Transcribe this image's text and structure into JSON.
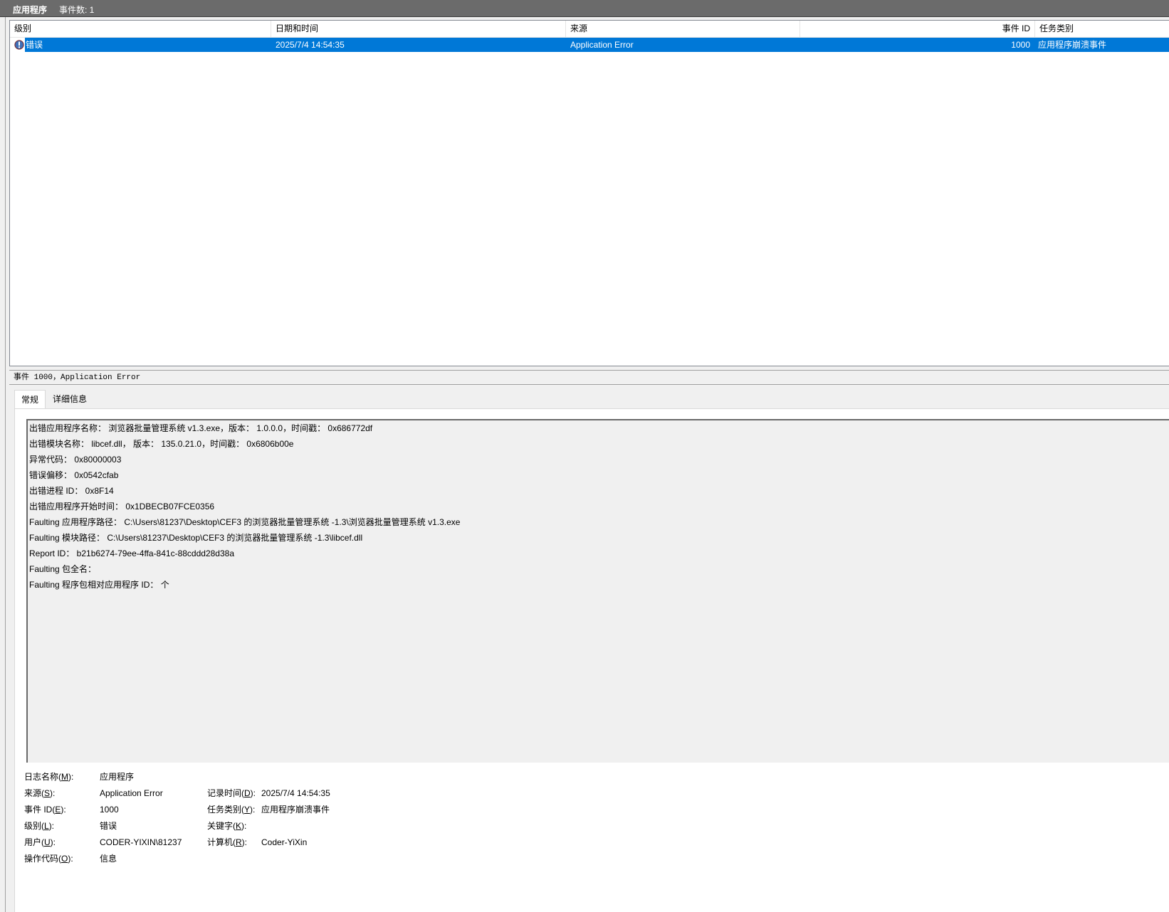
{
  "titlebar": {
    "log_name": "应用程序",
    "event_count": "事件数: 1"
  },
  "columns": [
    "级别",
    "日期和时间",
    "来源",
    "事件 ID",
    "任务类别"
  ],
  "events": [
    {
      "level": "错误",
      "datetime": "2025/7/4 14:54:35",
      "source": "Application Error",
      "event_id": "1000",
      "task": "应用程序崩溃事件",
      "icon": "error-icon",
      "selected": true
    }
  ],
  "detail": {
    "title": "事件 1000，Application Error",
    "tabs": [
      "常规",
      "详细信息"
    ],
    "description": [
      "出错应用程序名称： 浏览器批量管理系统 v1.3.exe，版本： 1.0.0.0，时间戳： 0x686772df",
      "出错模块名称： libcef.dll， 版本： 135.0.21.0，时间戳： 0x6806b00e",
      "异常代码： 0x80000003",
      "错误偏移： 0x0542cfab",
      "出错进程 ID： 0x8F14",
      "出错应用程序开始时间： 0x1DBECB07FCE0356",
      "Faulting 应用程序路径： C:\\Users\\81237\\Desktop\\CEF3 的浏览器批量管理系统 -1.3\\浏览器批量管理系统 v1.3.exe",
      "Faulting 模块路径： C:\\Users\\81237\\Desktop\\CEF3 的浏览器批量管理系统 -1.3\\libcef.dll",
      "Report ID： b21b6274-79ee-4ffa-841c-88cddd28d38a",
      "Faulting 包全名：",
      "Faulting 程序包相对应用程序 ID： 个"
    ],
    "properties": {
      "log_name_label": [
        "日志名称(",
        "M",
        "):"
      ],
      "log_name_value": "应用程序",
      "source_label": [
        "来源(",
        "S",
        "):"
      ],
      "source_value": "Application Error",
      "logged_label": [
        "记录时间(",
        "D",
        "):"
      ],
      "logged_value": "2025/7/4 14:54:35",
      "event_id_label": [
        "事件 ID(",
        "E",
        "):"
      ],
      "event_id_value": "1000",
      "task_label": [
        "任务类别(",
        "Y",
        "):"
      ],
      "task_value": "应用程序崩溃事件",
      "level_label": [
        "级别(",
        "L",
        "):"
      ],
      "level_value": "错误",
      "keywords_label": [
        "关键字(",
        "K",
        "):"
      ],
      "keywords_value": "",
      "user_label": [
        "用户(",
        "U",
        "):"
      ],
      "user_value": "CODER-YIXIN\\81237",
      "computer_label": [
        "计算机(",
        "R",
        "):"
      ],
      "computer_value": "Coder-YiXin",
      "opcode_label": [
        "操作代码(",
        "O",
        "):"
      ],
      "opcode_value": "信息"
    }
  },
  "colors": {
    "selection": "#0078d7",
    "titlebar": "#6b6b6b",
    "background": "#f0f0f0"
  }
}
